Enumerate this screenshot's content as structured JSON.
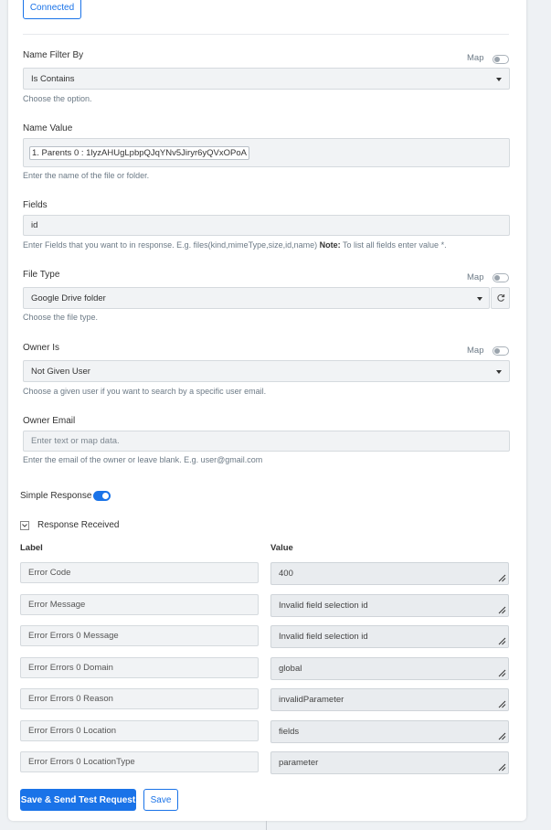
{
  "connection": {
    "status_label": "Connected"
  },
  "name_filter": {
    "label": "Name Filter By",
    "map_label": "Map",
    "value": "Is Contains",
    "help": "Choose the option."
  },
  "name_value": {
    "label": "Name Value",
    "chip": "1. Parents 0 : 1lyzAHUgLpbpQJqYNv5Jiryr6yQVxOPoA",
    "help": "Enter the name of the file or folder."
  },
  "fields": {
    "label": "Fields",
    "value": "id",
    "help": "Enter Fields that you want to in response. E.g. files(kind,mimeType,size,id,name)",
    "note_label": "Note:",
    "note_text": "To list all fields enter value *."
  },
  "file_type": {
    "label": "File Type",
    "map_label": "Map",
    "value": "Google Drive folder",
    "help": "Choose the file type."
  },
  "owner_is": {
    "label": "Owner Is",
    "map_label": "Map",
    "value": "Not Given User",
    "help": "Choose a given user if you want to search by a specific user email."
  },
  "owner_email": {
    "label": "Owner Email",
    "placeholder": "Enter text or map data.",
    "help": "Enter the email of the owner or leave blank. E.g. user@gmail.com"
  },
  "simple_response": {
    "label": "Simple Response",
    "enabled": true
  },
  "response": {
    "label": "Response Received",
    "col_label": "Label",
    "col_value": "Value",
    "rows": [
      {
        "label": "Error Code",
        "value": "400"
      },
      {
        "label": "Error Message",
        "value": "Invalid field selection id"
      },
      {
        "label": "Error Errors 0 Message",
        "value": "Invalid field selection id"
      },
      {
        "label": "Error Errors 0 Domain",
        "value": "global"
      },
      {
        "label": "Error Errors 0 Reason",
        "value": "invalidParameter"
      },
      {
        "label": "Error Errors 0 Location",
        "value": "fields"
      },
      {
        "label": "Error Errors 0 LocationType",
        "value": "parameter"
      }
    ]
  },
  "actions": {
    "save_send_label": "Save & Send Test Request",
    "save_label": "Save"
  },
  "colors": {
    "accent": "#1a73e8",
    "field_bg": "#f1f3f5",
    "value_bg": "#e9ecef"
  },
  "icons": {
    "dropdown": "caret-down-icon",
    "refresh": "refresh-icon",
    "resize": "resize-grip-icon",
    "collapse": "chevron-down-icon"
  }
}
